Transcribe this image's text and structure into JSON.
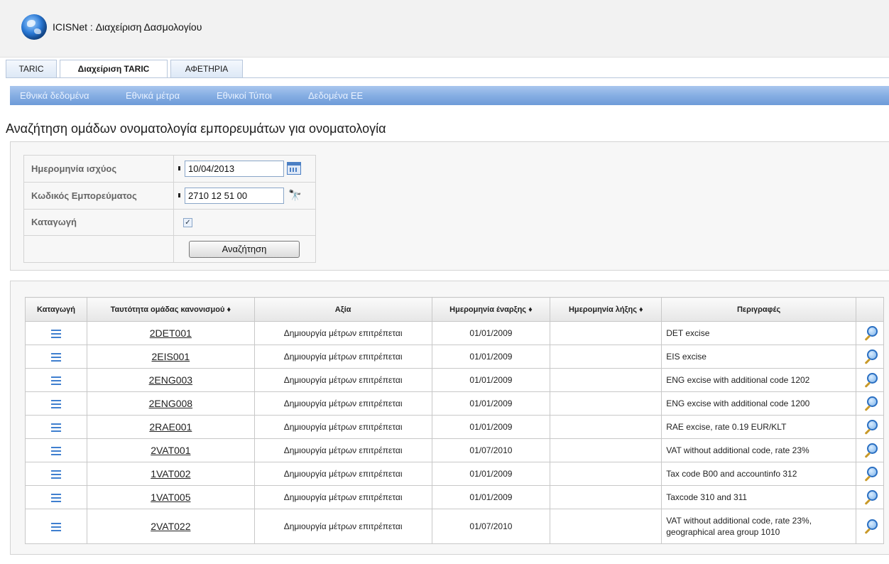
{
  "app": {
    "title": "ICISNet : Διαχείριση Δασμολογίου"
  },
  "tabs": [
    {
      "label": "TARIC"
    },
    {
      "label": "Διαχείριση TARIC",
      "active": true
    },
    {
      "label": "ΑΦΕΤΗΡΙΑ"
    }
  ],
  "menu": [
    {
      "label": "Εθνικά δεδομένα"
    },
    {
      "label": "Εθνικά μέτρα"
    },
    {
      "label": "Εθνικοί Τύποι"
    },
    {
      "label": "Δεδομένα ΕΕ"
    }
  ],
  "page": {
    "title": "Αναζήτηση ομάδων ονοματολογία εμπορευμάτων για ονοματολογία"
  },
  "form": {
    "date_label": "Ημερομηνία ισχύος",
    "date_value": "10/04/2013",
    "code_label": "Κωδικός Εμπορεύματος",
    "code_value": "2710 12 51 00",
    "origin_label": "Καταγωγή",
    "origin_checked": true,
    "search_button": "Αναζήτηση"
  },
  "table": {
    "columns": [
      "Καταγωγή",
      "Ταυτότητα ομάδας κανονισμού ♦",
      "Αξία",
      "Ημερομηνία έναρξης ♦",
      "Ημερομηνία λήξης ♦",
      "Περιγραφές",
      ""
    ],
    "rows": [
      {
        "code": "2DET001",
        "value": "Δημιουργία μέτρων επιτρέπεται",
        "start": "01/01/2009",
        "end": "",
        "desc": "DET excise"
      },
      {
        "code": "2EIS001",
        "value": "Δημιουργία μέτρων επιτρέπεται",
        "start": "01/01/2009",
        "end": "",
        "desc": "EIS excise"
      },
      {
        "code": "2ENG003",
        "value": "Δημιουργία μέτρων επιτρέπεται",
        "start": "01/01/2009",
        "end": "",
        "desc": "ENG excise with additional code 1202"
      },
      {
        "code": "2ENG008",
        "value": "Δημιουργία μέτρων επιτρέπεται",
        "start": "01/01/2009",
        "end": "",
        "desc": "ENG excise with additional code 1200"
      },
      {
        "code": "2RAE001",
        "value": "Δημιουργία μέτρων επιτρέπεται",
        "start": "01/01/2009",
        "end": "",
        "desc": "RAE excise, rate 0.19 EUR/KLT"
      },
      {
        "code": "2VAT001",
        "value": "Δημιουργία μέτρων επιτρέπεται",
        "start": "01/07/2010",
        "end": "",
        "desc": "VAT without additional code, rate 23%"
      },
      {
        "code": "1VAT002",
        "value": "Δημιουργία μέτρων επιτρέπεται",
        "start": "01/01/2009",
        "end": "",
        "desc": "Tax code B00 and accountinfo 312"
      },
      {
        "code": "1VAT005",
        "value": "Δημιουργία μέτρων επιτρέπεται",
        "start": "01/01/2009",
        "end": "",
        "desc": "Taxcode 310 and 311"
      },
      {
        "code": "2VAT022",
        "value": "Δημιουργία μέτρων επιτρέπεται",
        "start": "01/07/2010",
        "end": "",
        "desc": "VAT without additional code, rate 23%, geographical area group 1010"
      }
    ]
  }
}
